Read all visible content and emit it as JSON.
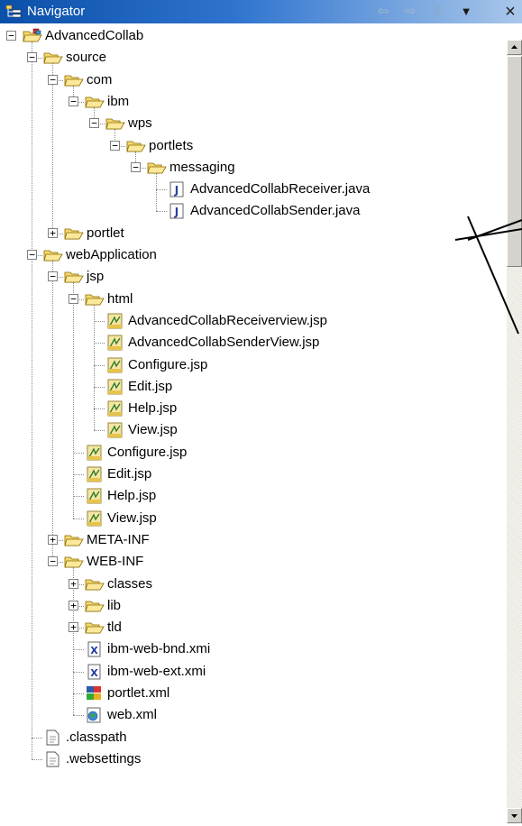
{
  "window": {
    "title": "Navigator",
    "icon": "navigator-view-icon",
    "controls": [
      {
        "name": "back-button",
        "glyph": "⇦"
      },
      {
        "name": "forward-button",
        "glyph": "⇨"
      },
      {
        "name": "up-button",
        "glyph": "⇧"
      },
      {
        "name": "view-menu-button",
        "glyph": "▼"
      },
      {
        "name": "close-button",
        "glyph": "×"
      }
    ]
  },
  "tree": [
    {
      "label": "AdvancedCollab",
      "depth": 0,
      "type": "project",
      "expander": "minus"
    },
    {
      "label": "source",
      "depth": 1,
      "type": "folder",
      "expander": "minus"
    },
    {
      "label": "com",
      "depth": 2,
      "type": "folder",
      "expander": "minus"
    },
    {
      "label": "ibm",
      "depth": 3,
      "type": "folder",
      "expander": "minus"
    },
    {
      "label": "wps",
      "depth": 4,
      "type": "folder",
      "expander": "minus"
    },
    {
      "label": "portlets",
      "depth": 5,
      "type": "folder",
      "expander": "minus"
    },
    {
      "label": "messaging",
      "depth": 6,
      "type": "folder",
      "expander": "minus"
    },
    {
      "label": "AdvancedCollabReceiver.java",
      "depth": 7,
      "type": "java"
    },
    {
      "label": "AdvancedCollabSender.java",
      "depth": 7,
      "type": "java"
    },
    {
      "label": "portlet",
      "depth": 2,
      "type": "folder",
      "expander": "plus"
    },
    {
      "label": "webApplication",
      "depth": 1,
      "type": "folder",
      "expander": "minus"
    },
    {
      "label": "jsp",
      "depth": 2,
      "type": "folder",
      "expander": "minus"
    },
    {
      "label": "html",
      "depth": 3,
      "type": "folder",
      "expander": "minus"
    },
    {
      "label": "AdvancedCollabReceiverview.jsp",
      "depth": 4,
      "type": "jsp"
    },
    {
      "label": "AdvancedCollabSenderView.jsp",
      "depth": 4,
      "type": "jsp"
    },
    {
      "label": "Configure.jsp",
      "depth": 4,
      "type": "jsp"
    },
    {
      "label": "Edit.jsp",
      "depth": 4,
      "type": "jsp"
    },
    {
      "label": "Help.jsp",
      "depth": 4,
      "type": "jsp"
    },
    {
      "label": "View.jsp",
      "depth": 4,
      "type": "jsp"
    },
    {
      "label": "Configure.jsp",
      "depth": 3,
      "type": "jsp"
    },
    {
      "label": "Edit.jsp",
      "depth": 3,
      "type": "jsp"
    },
    {
      "label": "Help.jsp",
      "depth": 3,
      "type": "jsp"
    },
    {
      "label": "View.jsp",
      "depth": 3,
      "type": "jsp"
    },
    {
      "label": "META-INF",
      "depth": 2,
      "type": "folder",
      "expander": "plus"
    },
    {
      "label": "WEB-INF",
      "depth": 2,
      "type": "folder",
      "expander": "minus"
    },
    {
      "label": "classes",
      "depth": 3,
      "type": "folder",
      "expander": "plus"
    },
    {
      "label": "lib",
      "depth": 3,
      "type": "folder",
      "expander": "plus"
    },
    {
      "label": "tld",
      "depth": 3,
      "type": "folder",
      "expander": "plus"
    },
    {
      "label": "ibm-web-bnd.xmi",
      "depth": 3,
      "type": "xmi"
    },
    {
      "label": "ibm-web-ext.xmi",
      "depth": 3,
      "type": "xmi"
    },
    {
      "label": "portlet.xml",
      "depth": 3,
      "type": "portletxml"
    },
    {
      "label": "web.xml",
      "depth": 3,
      "type": "webxml"
    },
    {
      "label": ".classpath",
      "depth": 1,
      "type": "file"
    },
    {
      "label": ".websettings",
      "depth": 1,
      "type": "file"
    }
  ],
  "colors": {
    "title_start": "#0a4fa8",
    "title_end": "#a9c7ea",
    "folder": "#f5d76e",
    "java_blue": "#2a3f9e"
  }
}
